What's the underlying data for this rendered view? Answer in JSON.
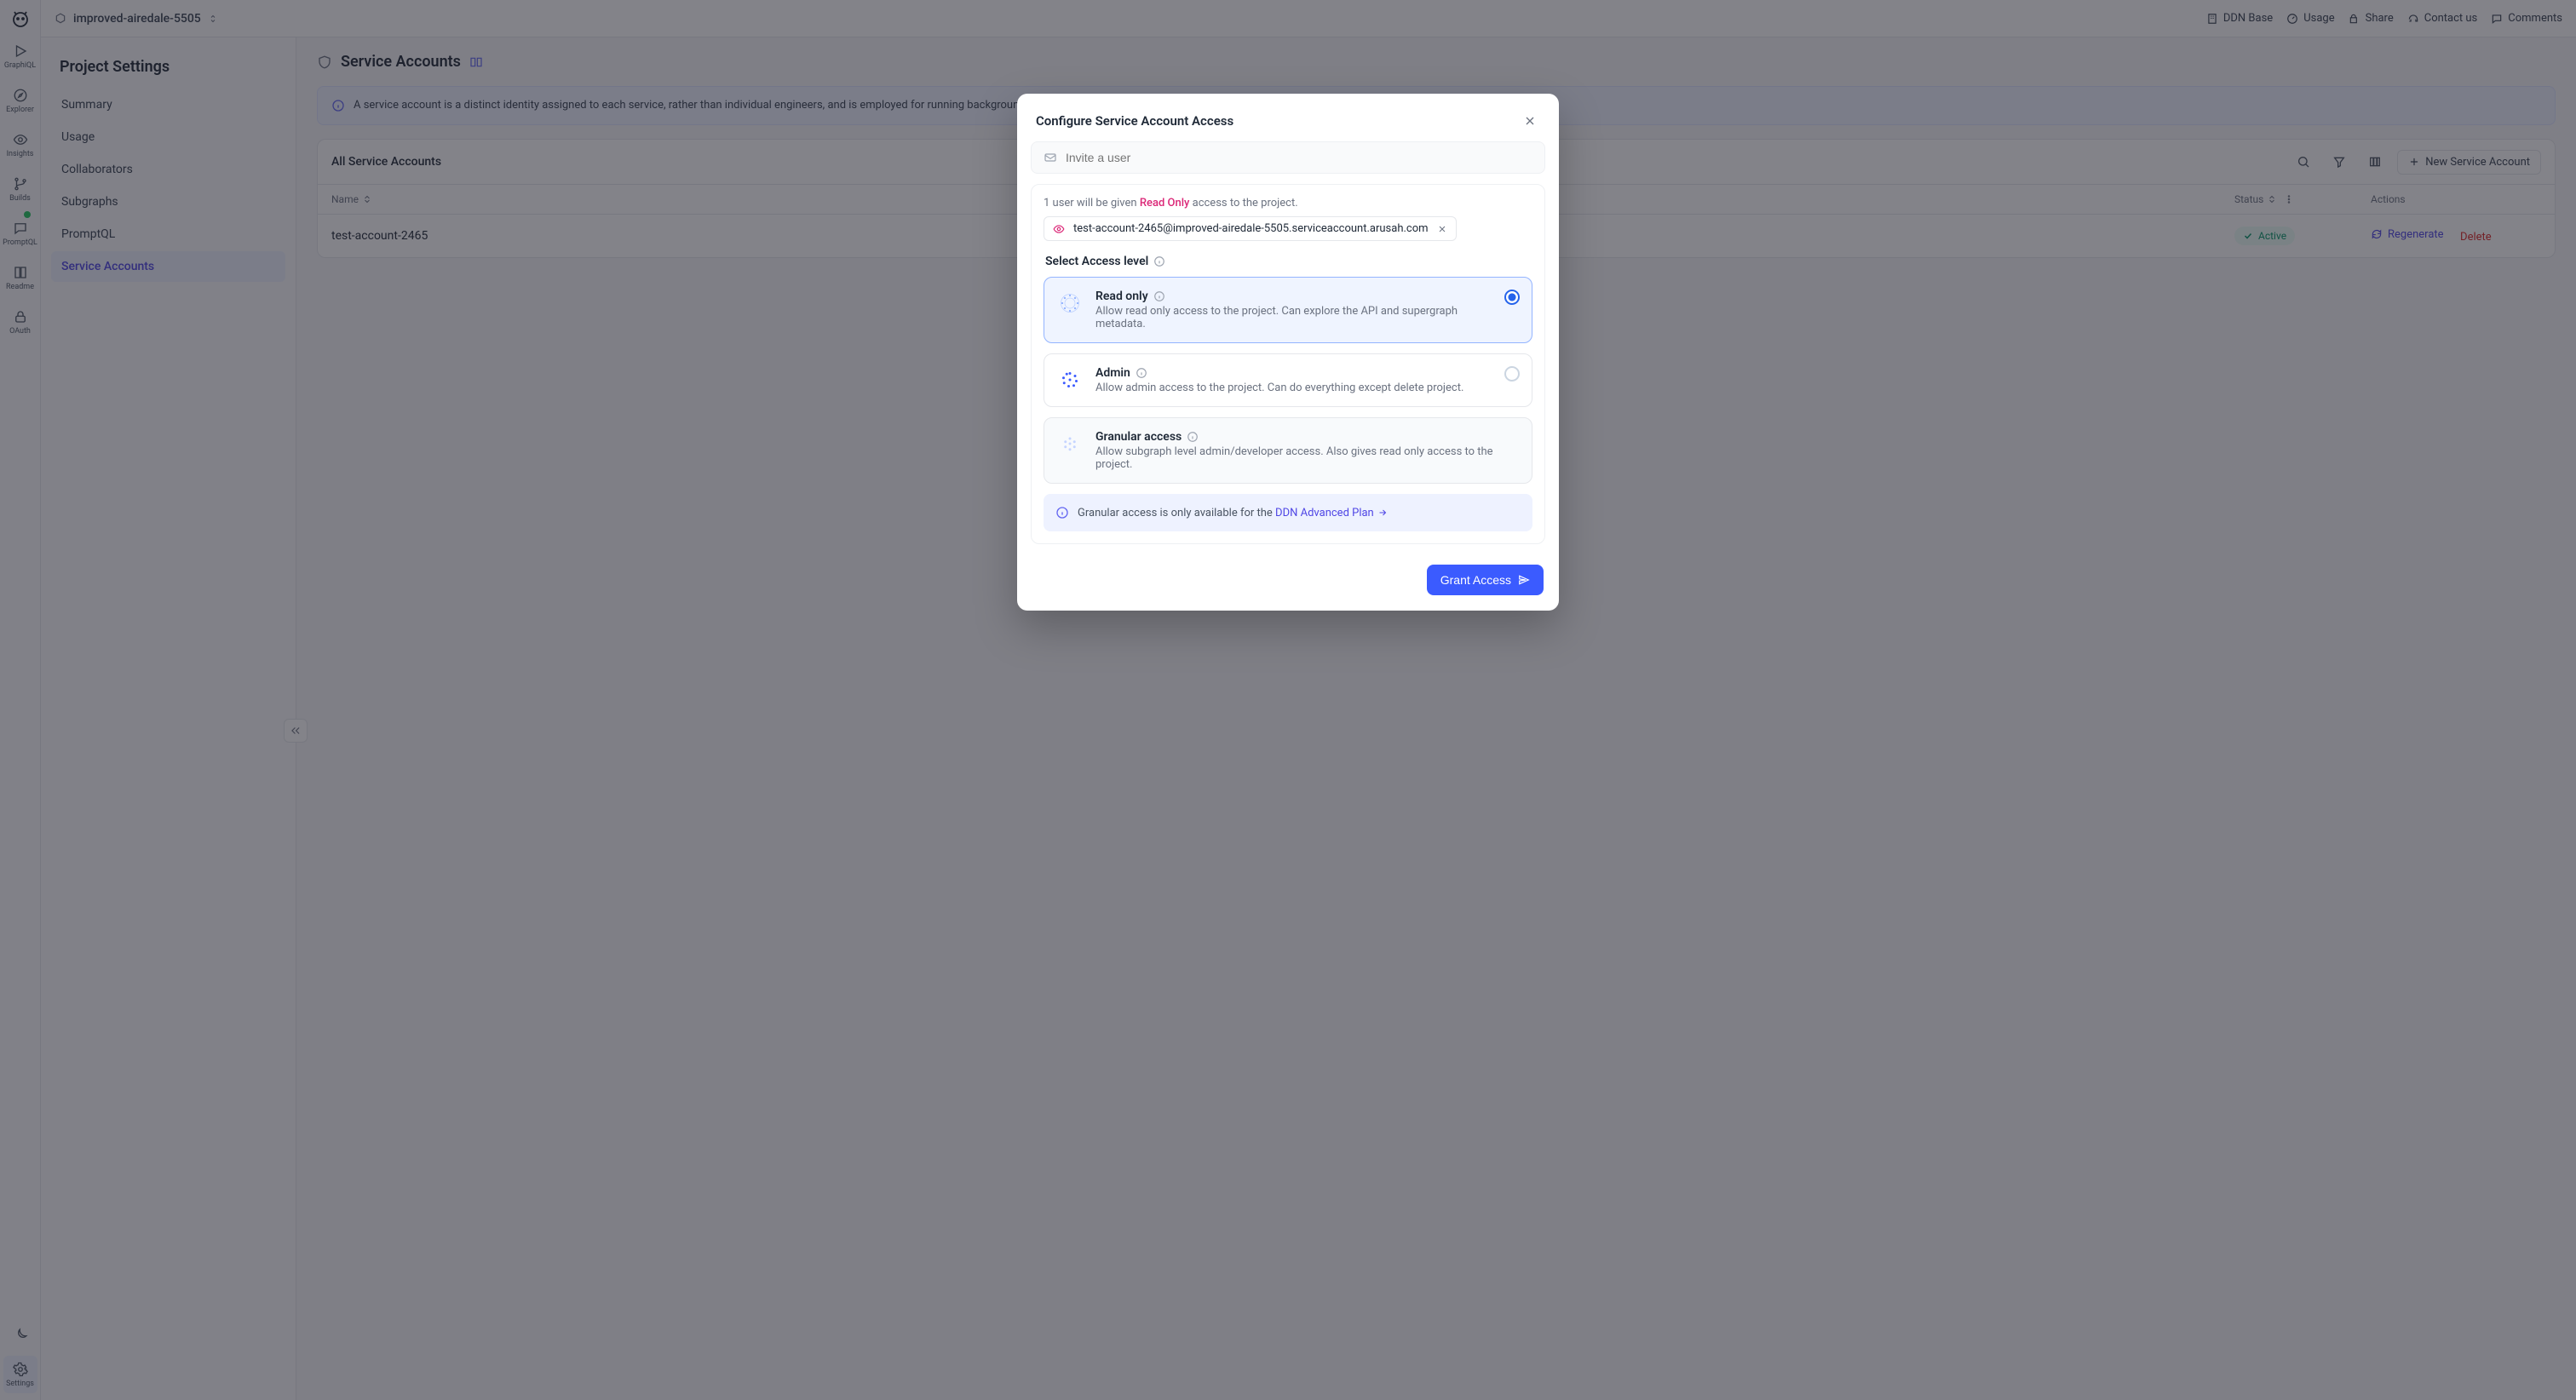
{
  "topbar": {
    "project_name": "improved-airedale-5505",
    "links": {
      "ddn_base": "DDN Base",
      "usage": "Usage",
      "share": "Share",
      "contact": "Contact us",
      "comments": "Comments"
    }
  },
  "rail": {
    "items": [
      {
        "label": "GraphiQL"
      },
      {
        "label": "Explorer"
      },
      {
        "label": "Insights"
      },
      {
        "label": "Builds"
      },
      {
        "label": "PromptQL"
      },
      {
        "label": "Readme"
      },
      {
        "label": "OAuth"
      }
    ],
    "settings_label": "Settings"
  },
  "sidebar": {
    "title": "Project Settings",
    "items": [
      {
        "label": "Summary"
      },
      {
        "label": "Usage"
      },
      {
        "label": "Collaborators"
      },
      {
        "label": "Subgraphs"
      },
      {
        "label": "PromptQL"
      },
      {
        "label": "Service Accounts"
      }
    ]
  },
  "page": {
    "title": "Service Accounts",
    "banner": "A service account is a distinct identity assigned to each service, rather than individual engineers, and is employed for running background jobs, connecting systems, or performing automated tasks.",
    "table": {
      "tab_all": "All Service Accounts",
      "new_btn": "New Service Account",
      "col_name": "Name",
      "col_status": "Status",
      "col_actions": "Actions",
      "rows": [
        {
          "name": "test-account-2465",
          "status": "Active",
          "regen": "Regenerate",
          "del": "Delete"
        }
      ]
    }
  },
  "modal": {
    "title": "Configure Service Account Access",
    "invite_placeholder": "Invite a user",
    "hint_pre": "1 user will be given ",
    "hint_role": "Read Only",
    "hint_post": " access to the project.",
    "chip_email": "test-account-2465@improved-airedale-5505.serviceaccount.arusah.com",
    "section_label": "Select Access level",
    "options": [
      {
        "title": "Read only",
        "desc": "Allow read only access to the project. Can explore the API and supergraph metadata.",
        "selected": true
      },
      {
        "title": "Admin",
        "desc": "Allow admin access to the project. Can do everything except delete project.",
        "selected": false
      },
      {
        "title": "Granular access",
        "desc": "Allow subgraph level admin/developer access. Also gives read only access to the project.",
        "disabled": true
      }
    ],
    "plan_banner_pre": "Granular access is only available for the ",
    "plan_banner_link": "DDN Advanced Plan",
    "grant_btn": "Grant Access"
  }
}
